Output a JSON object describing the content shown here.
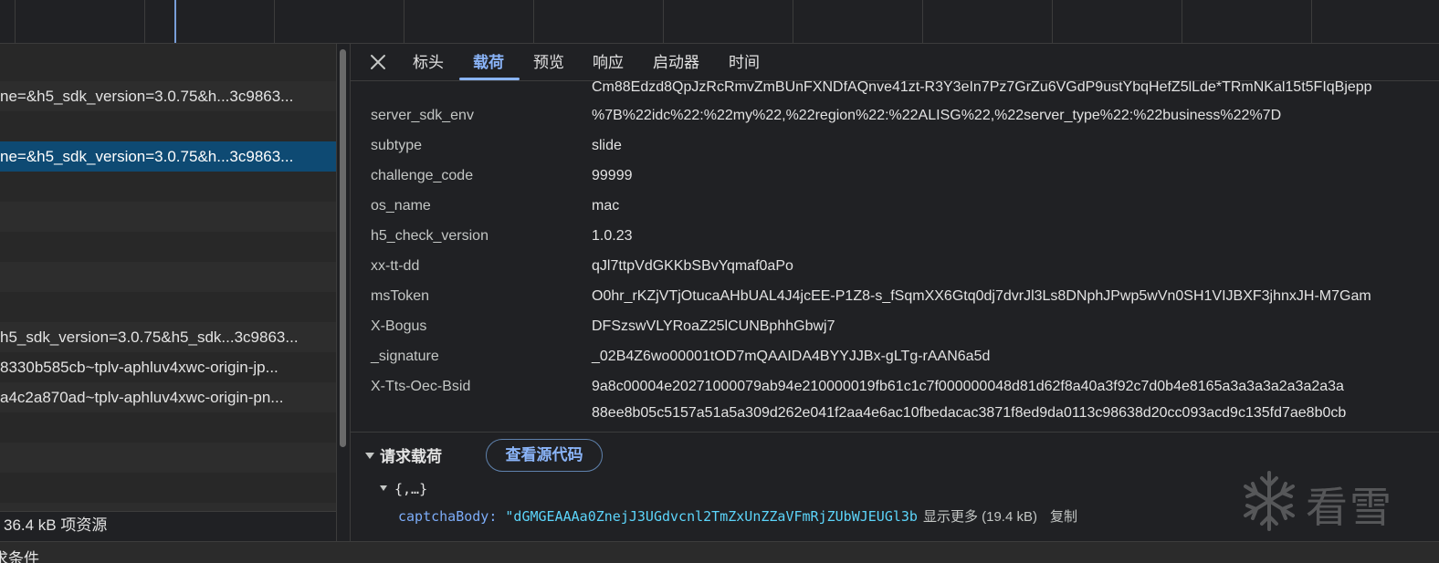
{
  "requests": [
    "",
    "ne=&h5_sdk_version=3.0.75&h...3c9863...",
    "",
    "ne=&h5_sdk_version=3.0.75&h...3c9863...",
    "",
    "",
    "",
    "",
    "",
    "h5_sdk_version=3.0.75&h5_sdk...3c9863...",
    "8330b585cb~tplv-aphluv4xwc-origin-jp...",
    "a4c2a870ad~tplv-aphluv4xwc-origin-pn...",
    "",
    "",
    "",
    ""
  ],
  "selected_request_index": 3,
  "status_bar": {
    "text": " 36.4 kB 项资源"
  },
  "bottom_strip": {
    "text": "求条件"
  },
  "tabs": {
    "close_icon": "close-icon",
    "items": [
      "标头",
      "载荷",
      "预览",
      "响应",
      "启动器",
      "时间"
    ],
    "active": "载荷"
  },
  "params": [
    {
      "key": "",
      "value": "Cm88Edzd8QpJzRcRmvZmBUnFXNDfAQnve41zt-R3Y3eIn7Pz7GrZu6VGdP9ustYbqHefZ5lLde*TRmNKal15t5FIqBjepp"
    },
    {
      "key": "server_sdk_env",
      "value": "%7B%22idc%22:%22my%22,%22region%22:%22ALISG%22,%22server_type%22:%22business%22%7D"
    },
    {
      "key": "subtype",
      "value": "slide"
    },
    {
      "key": "challenge_code",
      "value": "99999"
    },
    {
      "key": "os_name",
      "value": "mac"
    },
    {
      "key": "h5_check_version",
      "value": "1.0.23"
    },
    {
      "key": "xx-tt-dd",
      "value": "qJl7ttpVdGKKbSBvYqmaf0aPo"
    },
    {
      "key": "msToken",
      "value": "O0hr_rKZjVTjOtucaAHbUAL4J4jcEE-P1Z8-s_fSqmXX6Gtq0dj7dvrJl3Ls8DNphJPwp5wVn0SH1VIJBXF3jhnxJH-M7Gam"
    },
    {
      "key": "X-Bogus",
      "value": "DFSzswVLYRoaZ25lCUNBphhGbwj7"
    },
    {
      "key": "_signature",
      "value": "_02B4Z6wo00001tOD7mQAAIDA4BYYJJBx-gLTg-rAAN6a5d"
    },
    {
      "key": "X-Tts-Oec-Bsid",
      "value": "9a8c00004e20271000079ab94e210000019fb61c1c7f000000048d81d62f8a40a3f92c7d0b4e8165a3a3a3a2a3a2a3a"
    },
    {
      "key": "",
      "value": "88ee8b05c5157a51a5a309d262e041f2aa4e6ac10fbedacac3871f8ed9da0113c98638d20cc093acd9c135fd7ae8b0cb"
    }
  ],
  "payload": {
    "heading": "请求载荷",
    "view_source_label": "查看源代码",
    "object_summary": "{,…}",
    "body_key": "captchaBody",
    "body_colon": ": ",
    "body_value": "\"dGMGEAAAa0ZnejJ3UGdvcnl2TmZxUnZZaVFmRjZUbWJEUGl3b",
    "show_more": "显示更多 (19.4 kB)",
    "copy_label": "复制"
  },
  "watermark": {
    "text": "看雪",
    "icon": "snowflake-icon"
  }
}
